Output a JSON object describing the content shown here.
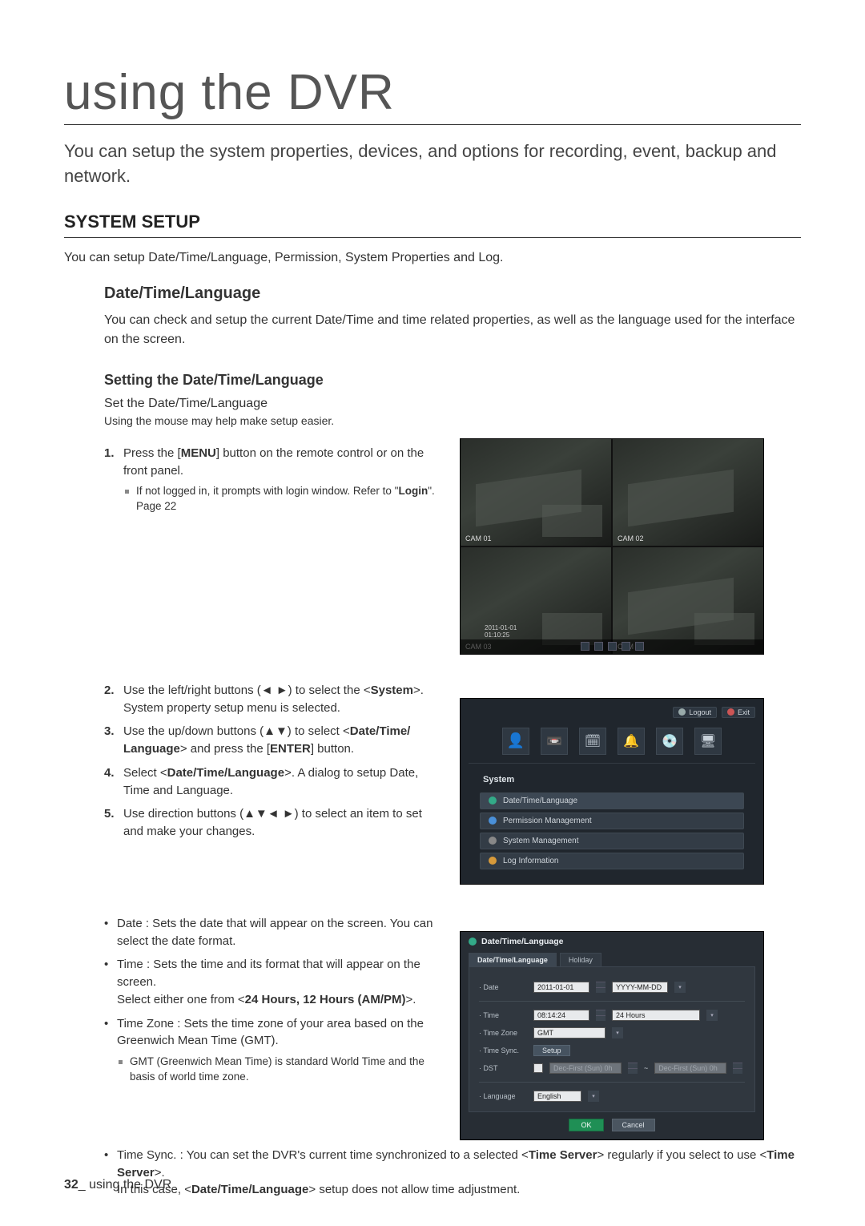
{
  "page_title": "using the DVR",
  "intro": "You can setup the system properties, devices, and options for recording, event, backup and network.",
  "section_heading": "SYSTEM SETUP",
  "section_intro": "You can setup Date/Time/Language, Permission, System Properties and Log.",
  "sub_heading": "Date/Time/Language",
  "sub_intro": "You can check and setup the current Date/Time and time related properties, as well as the language used for the interface on the screen.",
  "subsub_heading": "Setting the Date/Time/Language",
  "set_line": "Set the Date/Time/Language",
  "mouse_note": "Using the mouse may help make setup easier.",
  "steps": {
    "s1_a": "Press the [",
    "s1_menu": "MENU",
    "s1_b": "] button on the remote control or on the front panel.",
    "s1_sub_a": "If not logged in, it prompts with login window. Refer to \"",
    "s1_login": "Login",
    "s1_sub_b": "\". Page 22",
    "s2_a": "Use the left/right buttons (◄ ►) to select the <",
    "s2_system": "System",
    "s2_b": ">. System property setup menu is selected.",
    "s3_a": "Use the up/down buttons (▲▼) to select <",
    "s3_dtl": "Date/Time/ Language",
    "s3_b": "> and press the [",
    "s3_enter": "ENTER",
    "s3_c": "] button.",
    "s4_a": "Select <",
    "s4_dtl": "Date/Time/Language",
    "s4_b": ">. A dialog to setup Date, Time and Language.",
    "s5": "Use direction buttons (▲▼◄ ►) to select an item to set and make your changes."
  },
  "bul": {
    "date": "Date : Sets the date that will appear on the screen. You can select the date format.",
    "time_a": "Time : Sets the time and its format that will appear on the screen.",
    "time_b_a": "Select either one from <",
    "time_b_bold": "24 Hours, 12 Hours (AM/PM)",
    "time_b_b": ">.",
    "tz": "Time Zone : Sets the time zone of your area based on the Greenwich Mean Time (GMT).",
    "tz_sub": "GMT (Greenwich Mean Time) is standard World Time and the basis of world time zone.",
    "tsync_a": "Time Sync. : You can set the DVR's current time synchronized to a selected <",
    "tsync_ts": "Time Server",
    "tsync_b": "> regularly if you select to use <",
    "tsync_c": ">.",
    "tsync_d_a": "In this case, <",
    "tsync_d_bold": "Date/Time/Language",
    "tsync_d_b": "> setup does not allow time adjustment."
  },
  "quad": {
    "timestamp_top": "2011-01-01 01:10:25",
    "ts2_a": "2011-01-01",
    "ts2_b": "01:10:25",
    "cam1": "CAM 01",
    "cam2": "CAM 02",
    "cam3": "CAM 03",
    "cam4": "CAM 04"
  },
  "sysmenu": {
    "logout": "Logout",
    "exit": "Exit",
    "heading": "System",
    "r1": "Date/Time/Language",
    "r2": "Permission Management",
    "r3": "System Management",
    "r4": "Log Information"
  },
  "dtl": {
    "title": "Date/Time/Language",
    "tab1": "Date/Time/Language",
    "tab2": "Holiday",
    "l_date": "· Date",
    "v_date": "2011-01-01",
    "v_datefmt": "YYYY-MM-DD",
    "l_time": "· Time",
    "v_time": "08:14:24",
    "v_timefmt": "24 Hours",
    "l_tz": "· Time Zone",
    "v_tz": "GMT",
    "l_tsync": "· Time Sync.",
    "btn_setup": "Setup",
    "l_dst": "· DST",
    "v_dst1": "Dec-First (Sun) 0h",
    "tilde": "~",
    "v_dst2": "Dec-First (Sun) 0h",
    "l_lang": "· Language",
    "v_lang": "English",
    "ok": "OK",
    "cancel": "Cancel"
  },
  "footer": {
    "pagenum": "32",
    "sep": "_ ",
    "text": "using the DVR"
  }
}
